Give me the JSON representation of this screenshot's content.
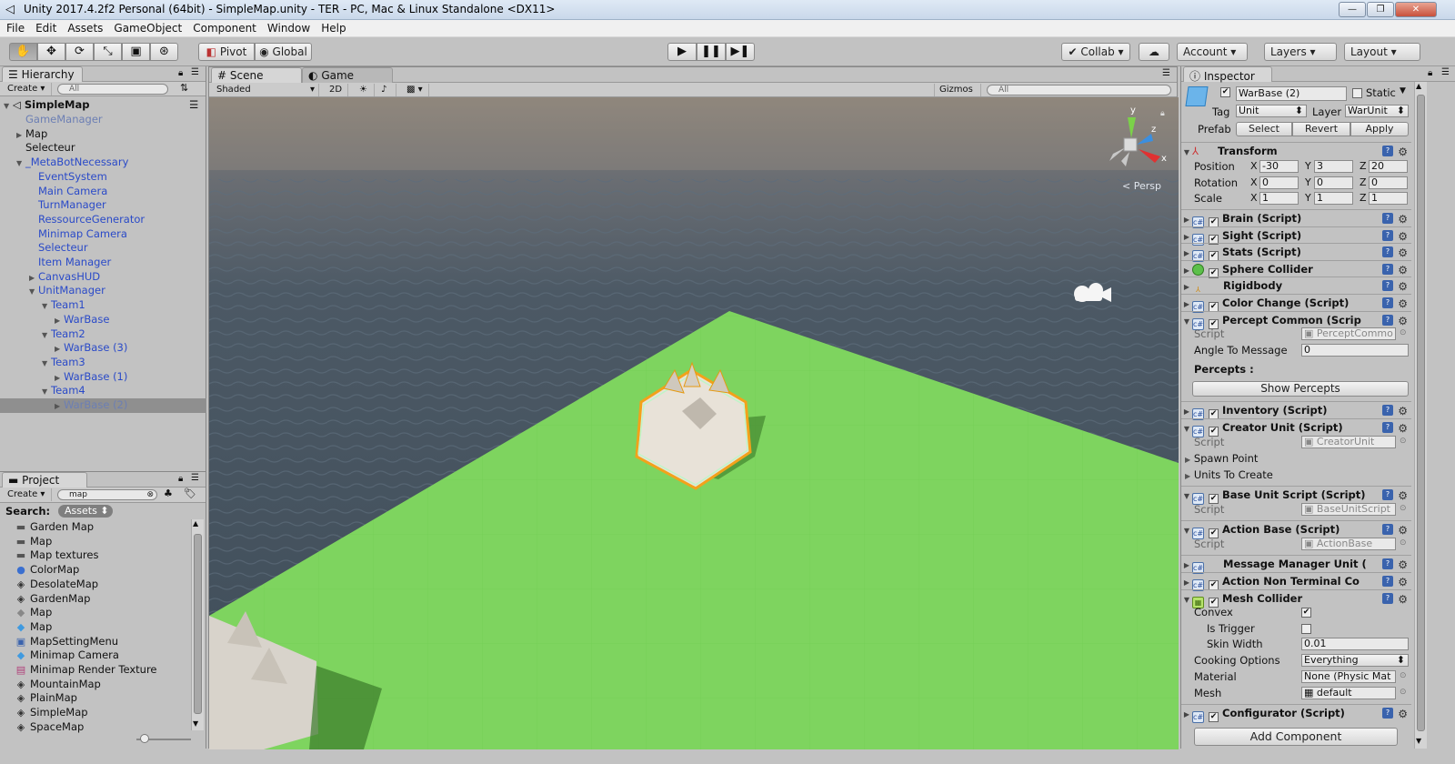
{
  "window": {
    "title": "Unity 2017.4.2f2 Personal (64bit) - SimpleMap.unity - TER - PC, Mac & Linux Standalone <DX11>",
    "minimize": "—",
    "maximize": "❐",
    "close": "✕"
  },
  "menu": [
    "File",
    "Edit",
    "Assets",
    "GameObject",
    "Component",
    "Window",
    "Help"
  ],
  "toolbar": {
    "pivot": "Pivot",
    "global": "Global",
    "collab": "Collab",
    "account": "Account",
    "layers": "Layers",
    "layout": "Layout"
  },
  "hierarchy": {
    "tab": "Hierarchy",
    "create": "Create",
    "search_placeholder": "All",
    "scene": "SimpleMap",
    "rows": [
      {
        "label": "GameManager",
        "indent": 1,
        "arrow": "",
        "style": "gray"
      },
      {
        "label": "Map",
        "indent": 1,
        "arrow": "▶",
        "style": ""
      },
      {
        "label": "Selecteur",
        "indent": 1,
        "arrow": "",
        "style": ""
      },
      {
        "label": "_MetaBotNecessary",
        "indent": 1,
        "arrow": "▼",
        "style": "blue"
      },
      {
        "label": "EventSystem",
        "indent": 2,
        "arrow": "",
        "style": "blue"
      },
      {
        "label": "Main Camera",
        "indent": 2,
        "arrow": "",
        "style": "blue"
      },
      {
        "label": "TurnManager",
        "indent": 2,
        "arrow": "",
        "style": "blue"
      },
      {
        "label": "RessourceGenerator",
        "indent": 2,
        "arrow": "",
        "style": "blue"
      },
      {
        "label": "Minimap Camera",
        "indent": 2,
        "arrow": "",
        "style": "blue"
      },
      {
        "label": "Selecteur",
        "indent": 2,
        "arrow": "",
        "style": "blue"
      },
      {
        "label": "Item Manager",
        "indent": 2,
        "arrow": "",
        "style": "blue"
      },
      {
        "label": "CanvasHUD",
        "indent": 2,
        "arrow": "▶",
        "style": "blue"
      },
      {
        "label": "UnitManager",
        "indent": 2,
        "arrow": "▼",
        "style": "blue"
      },
      {
        "label": "Team1",
        "indent": 3,
        "arrow": "▼",
        "style": "blue"
      },
      {
        "label": "WarBase",
        "indent": 4,
        "arrow": "▶",
        "style": "blue"
      },
      {
        "label": "Team2",
        "indent": 3,
        "arrow": "▼",
        "style": "blue"
      },
      {
        "label": "WarBase (3)",
        "indent": 4,
        "arrow": "▶",
        "style": "blue"
      },
      {
        "label": "Team3",
        "indent": 3,
        "arrow": "▼",
        "style": "blue"
      },
      {
        "label": "WarBase (1)",
        "indent": 4,
        "arrow": "▶",
        "style": "blue"
      },
      {
        "label": "Team4",
        "indent": 3,
        "arrow": "▼",
        "style": "blue"
      },
      {
        "label": "WarBase (2)",
        "indent": 4,
        "arrow": "▶",
        "style": "gray sel"
      }
    ]
  },
  "project": {
    "tab": "Project",
    "create": "Create",
    "search_value": "map",
    "search_label": "Search:",
    "scope": "Assets",
    "items": [
      {
        "label": "Garden Map",
        "icon": "folder-icon",
        "glyph": "▬"
      },
      {
        "label": "Map",
        "icon": "folder-icon",
        "glyph": "▬"
      },
      {
        "label": "Map textures",
        "icon": "folder-icon",
        "glyph": "▬"
      },
      {
        "label": "ColorMap",
        "icon": "sphere-icon",
        "glyph": "●"
      },
      {
        "label": "DesolateMap",
        "icon": "unity-scene-icon",
        "glyph": "◈"
      },
      {
        "label": "GardenMap",
        "icon": "unity-scene-icon",
        "glyph": "◈"
      },
      {
        "label": "Map",
        "icon": "mesh-icon",
        "glyph": "◆"
      },
      {
        "label": "Map",
        "icon": "prefab-icon",
        "glyph": "◆"
      },
      {
        "label": "MapSettingMenu",
        "icon": "script-icon",
        "glyph": "▣"
      },
      {
        "label": "Minimap Camera",
        "icon": "prefab-icon",
        "glyph": "◆"
      },
      {
        "label": "Minimap Render Texture",
        "icon": "render-texture-icon",
        "glyph": "▤"
      },
      {
        "label": "MountainMap",
        "icon": "unity-scene-icon",
        "glyph": "◈"
      },
      {
        "label": "PlainMap",
        "icon": "unity-scene-icon",
        "glyph": "◈"
      },
      {
        "label": "SimpleMap",
        "icon": "unity-scene-icon",
        "glyph": "◈"
      },
      {
        "label": "SpaceMap",
        "icon": "unity-scene-icon",
        "glyph": "◈"
      }
    ]
  },
  "scene": {
    "tab_scene": "Scene",
    "tab_game": "Game",
    "shading": "Shaded",
    "mode_2d": "2D",
    "gizmos": "Gizmos",
    "search_placeholder": "All",
    "persp": "Persp",
    "axis_x": "x",
    "axis_y": "y",
    "axis_z": "z"
  },
  "inspector": {
    "tab": "Inspector",
    "name": "WarBase (2)",
    "static": "Static",
    "tag_label": "Tag",
    "tag": "Unit",
    "layer_label": "Layer",
    "layer": "WarUnit",
    "prefab_label": "Prefab",
    "prefab_select": "Select",
    "prefab_revert": "Revert",
    "prefab_apply": "Apply",
    "transform": {
      "title": "Transform",
      "position_label": "Position",
      "px": "-30",
      "py": "3",
      "pz": "20",
      "rotation_label": "Rotation",
      "rx": "0",
      "ry": "0",
      "rz": "0",
      "scale_label": "Scale",
      "sx": "1",
      "sy": "1",
      "sz": "1"
    },
    "components_a": [
      "Brain (Script)",
      "Sight (Script)",
      "Stats (Script)",
      "Sphere Collider",
      "Rigidbody",
      "Color Change (Script)",
      "Percept Common (Scrip"
    ],
    "percept_script": "PerceptCommo",
    "angle_label": "Angle To Message",
    "angle_value": "0",
    "percepts_label": "Percepts :",
    "show_percepts": "Show Percepts",
    "inventory": "Inventory (Script)",
    "creator": "Creator Unit (Script)",
    "creator_script": "CreatorUnit",
    "spawn_point": "Spawn Point",
    "units_to_create": "Units To Create",
    "base_unit": "Base Unit Script (Script)",
    "base_unit_script": "BaseUnitScript",
    "action_base": "Action Base (Script)",
    "action_base_script": "ActionBase",
    "message_manager": "Message Manager Unit (",
    "action_non_terminal": "Action Non Terminal Co",
    "mesh_collider": "Mesh Collider",
    "convex": "Convex",
    "is_trigger": "Is Trigger",
    "skin_width_label": "Skin Width",
    "skin_width": "0.01",
    "cooking_label": "Cooking Options",
    "cooking": "Everything",
    "material_label": "Material",
    "material": "None (Physic Mat",
    "mesh_label": "Mesh",
    "mesh": "default",
    "configurator": "Configurator (Script)",
    "script_label": "Script",
    "add_component": "Add Component"
  }
}
